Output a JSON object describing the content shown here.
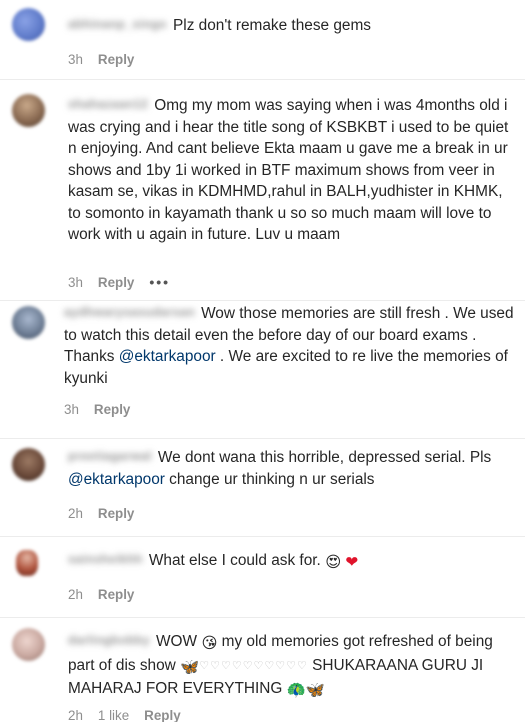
{
  "comments": [
    {
      "username": "abhinanp_singo",
      "text": "Plz don't remake these gems",
      "time": "3h",
      "reply_label": "Reply",
      "avatar_color": "#5d79c8"
    },
    {
      "username": "shahazaan12",
      "text": "Omg my mom was saying when i was 4months old i was crying and i hear the title song of KSBKBT i used to be quiet n enjoying. And cant believe Ekta maam u gave me a break in ur shows and 1by 1i worked in BTF maximum shows from veer in kasam se, vikas in KDMHMD,rahul in BALH,yudhister in KHMK, to somonto in kayamath thank u so so much maam will love to work with u again in future. Luv u maam",
      "time": "3h",
      "reply_label": "Reply",
      "more_label": "•••",
      "avatar_color": "#8a6a52"
    },
    {
      "username": "aydhwarysasudarsan",
      "text_before": "Wow those memories are still fresh . We used to watch this detail even the before day of our board exams . Thanks ",
      "mention": "@ektarkapoor",
      "text_after": " . We are excited to re live the memories of kyunki",
      "time": "3h",
      "reply_label": "Reply",
      "avatar_color": "#6f7f96"
    },
    {
      "username": "preetiagarwal",
      "text_before": "We dont wana this horrible, depressed serial. Pls ",
      "mention": "@ektarkapoor",
      "text_after": " change ur thinking n ur serials",
      "time": "2h",
      "reply_label": "Reply",
      "avatar_color": "#6b4a3a"
    },
    {
      "username": "sainsheikhh",
      "text": "What else I could ask for.",
      "emoji_1": "😍",
      "emoji_2": "❤",
      "time": "2h",
      "reply_label": "Reply",
      "avatar_color": "#b0553f"
    },
    {
      "username": "darlingbobby",
      "text_1": "WOW",
      "emoji_1": "😘",
      "text_2": "my old memories got refreshed of being part of dis show",
      "emoji_butterfly": "🦋",
      "emoji_hearts": "♡♡♡♡♡♡♡♡♡♡",
      "text_3": "SHUKARAANA GURU JI MAHARAJ FOR EVERYTHING",
      "emoji_peacock": "🦚",
      "time": "2h",
      "likes_label": "1 like",
      "reply_label": "Reply",
      "avatar_color": "#c9a8a0"
    }
  ]
}
